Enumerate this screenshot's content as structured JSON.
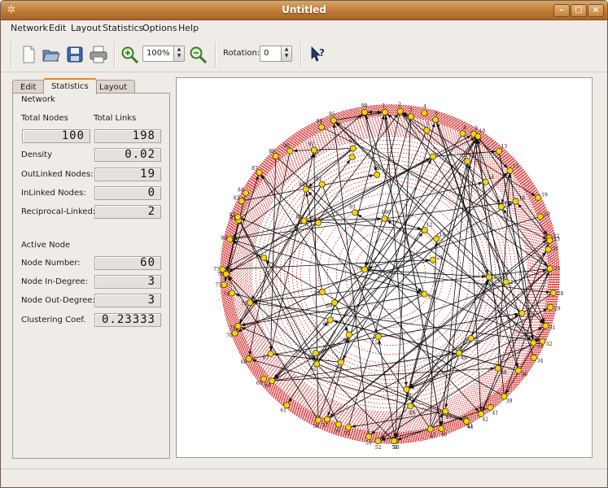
{
  "window": {
    "title": "Untitled"
  },
  "menu": [
    "Network",
    "Edit",
    "Layout",
    "Statistics",
    "Options",
    "Help"
  ],
  "toolbar": {
    "zoom_value": "100%",
    "rotation_label": "Rotation:",
    "rotation_value": "0"
  },
  "tabs": [
    "Edit",
    "Statistics",
    "Layout"
  ],
  "active_tab": "Statistics",
  "network": {
    "heading": "Network",
    "total_nodes_label": "Total Nodes",
    "total_links_label": "Total Links",
    "total_nodes": "100",
    "total_links": "198",
    "density_label": "Density",
    "density": "0.02",
    "outlinked_label": "OutLinked Nodes:",
    "outlinked": "19",
    "inlinked_label": "InLinked Nodes:",
    "inlinked": "0",
    "reciprocal_label": "Reciprocal-Linked:",
    "reciprocal": "2"
  },
  "active_node": {
    "heading": "Active Node",
    "number_label": "Node Number:",
    "number": "60",
    "in_degree_label": "Node In-Degree:",
    "in_degree": "3",
    "out_degree_label": "Node Out-Degree:",
    "out_degree": "3",
    "clustering_label": "Clustering Coef.",
    "clustering": "0.23333"
  },
  "graph": {
    "node_labels": [
      "1",
      "2",
      "3",
      "4",
      "5",
      "6",
      "7",
      "8",
      "9",
      "10",
      "11",
      "12",
      "13",
      "14",
      "15",
      "16",
      "17",
      "18",
      "19",
      "20",
      "21",
      "22",
      "23",
      "24",
      "25",
      "26",
      "27",
      "28",
      "29",
      "30",
      "31",
      "32",
      "33",
      "34",
      "35",
      "36",
      "37",
      "38",
      "39",
      "40",
      "41",
      "42",
      "43",
      "44",
      "45",
      "46",
      "47",
      "48",
      "49",
      "50",
      "51",
      "52",
      "53",
      "54",
      "55",
      "56",
      "57",
      "58",
      "59",
      "60",
      "61",
      "62",
      "63",
      "64",
      "65",
      "66",
      "67",
      "68",
      "69",
      "70",
      "71",
      "72",
      "73",
      "74",
      "75",
      "76",
      "77",
      "78",
      "79",
      "80",
      "81",
      "82",
      "83",
      "84",
      "85",
      "86",
      "87",
      "88",
      "89",
      "90",
      "91",
      "92",
      "93",
      "94",
      "95",
      "96",
      "97",
      "98",
      "99",
      "100"
    ],
    "colors": {
      "ring": "#d42020",
      "node": "#f5d40e",
      "node_border": "#3a3000",
      "edge": "#111111"
    }
  }
}
